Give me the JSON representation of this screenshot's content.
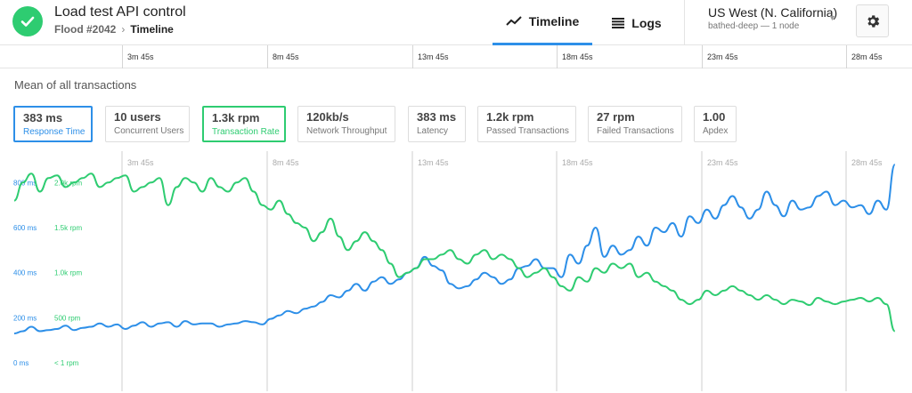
{
  "header": {
    "title": "Load test API control",
    "breadcrumb": {
      "parent": "Flood #2042",
      "current": "Timeline"
    },
    "tabs": [
      {
        "label": "Timeline",
        "icon": "trend-line-icon",
        "active": true
      },
      {
        "label": "Logs",
        "icon": "list-icon",
        "active": false
      }
    ],
    "region": {
      "name": "US West (N. California)",
      "subtitle": "bathed-deep — 1 node"
    },
    "status_icon": "check-icon",
    "settings_icon": "gear-icon"
  },
  "time_axis": [
    "3m 45s",
    "8m 45s",
    "13m 45s",
    "18m 45s",
    "23m 45s",
    "28m 45s"
  ],
  "section_title": "Mean of all transactions",
  "metrics": [
    {
      "value": "383 ms",
      "label": "Response Time",
      "selected": "blue"
    },
    {
      "value": "10 users",
      "label": "Concurrent Users",
      "selected": ""
    },
    {
      "value": "1.3k rpm",
      "label": "Transaction Rate",
      "selected": "green"
    },
    {
      "value": "120kb/s",
      "label": "Network Throughput",
      "selected": ""
    },
    {
      "value": "383 ms",
      "label": "Latency",
      "selected": ""
    },
    {
      "value": "1.2k rpm",
      "label": "Passed Transactions",
      "selected": ""
    },
    {
      "value": "27 rpm",
      "label": "Failed Transactions",
      "selected": ""
    },
    {
      "value": "1.00",
      "label": "Apdex",
      "selected": ""
    }
  ],
  "colors": {
    "response": "#2d8fe8",
    "transaction": "#2ecc71",
    "status": "#2ecc71"
  },
  "chart_data": {
    "type": "line",
    "x_ticks": [
      "3m 45s",
      "8m 45s",
      "13m 45s",
      "18m 45s",
      "23m 45s",
      "28m 45s"
    ],
    "y_left_ticks": [
      "0 ms",
      "200 ms",
      "400 ms",
      "600 ms",
      "800 ms"
    ],
    "y_right_ticks": [
      "< 1 rpm",
      "500 rpm",
      "1.0k rpm",
      "1.5k rpm",
      "2.0k rpm"
    ],
    "ylim_response_ms": [
      0,
      900
    ],
    "ylim_transaction_rpm": [
      0,
      2250
    ],
    "x_range_min": [
      0,
      31
    ],
    "series": [
      {
        "name": "Response Time",
        "axis": "left",
        "x": [
          0,
          0.3,
          0.6,
          0.9,
          1.2,
          1.5,
          1.8,
          2.1,
          2.4,
          2.7,
          3,
          3.3,
          3.6,
          3.9,
          4.2,
          4.5,
          4.8,
          5.1,
          5.4,
          5.7,
          6,
          6.3,
          6.6,
          6.9,
          7.2,
          7.5,
          7.8,
          8.1,
          8.4,
          8.7,
          9,
          9.3,
          9.6,
          9.9,
          10.2,
          10.5,
          10.8,
          11.1,
          11.4,
          11.7,
          12,
          12.3,
          12.6,
          12.9,
          13.2,
          13.5,
          13.8,
          14.1,
          14.4,
          14.7,
          15,
          15.3,
          15.6,
          15.9,
          16.2,
          16.5,
          16.8,
          17.1,
          17.4,
          17.7,
          18,
          18.3,
          18.6,
          18.9,
          19.2,
          19.5,
          19.8,
          20.1,
          20.4,
          20.7,
          21,
          21.3,
          21.6,
          21.9,
          22.2,
          22.5,
          22.8,
          23.1,
          23.4,
          23.7,
          24,
          24.3,
          24.6,
          24.9,
          25.2,
          25.5,
          25.8,
          26.1,
          26.4,
          26.7,
          27,
          27.3,
          27.6,
          27.9,
          28.2,
          28.5,
          28.8,
          29.1,
          29.4,
          29.7,
          30,
          30.3,
          30.6,
          30.9
        ],
        "values": [
          130,
          140,
          160,
          140,
          145,
          150,
          165,
          145,
          155,
          160,
          175,
          160,
          170,
          150,
          165,
          180,
          160,
          175,
          180,
          160,
          185,
          170,
          175,
          175,
          160,
          170,
          175,
          185,
          180,
          170,
          195,
          210,
          230,
          220,
          240,
          250,
          270,
          300,
          290,
          320,
          350,
          320,
          360,
          380,
          350,
          370,
          400,
          420,
          470,
          430,
          410,
          350,
          330,
          340,
          370,
          400,
          380,
          350,
          370,
          420,
          430,
          460,
          420,
          420,
          380,
          480,
          440,
          520,
          600,
          470,
          520,
          480,
          500,
          560,
          520,
          600,
          580,
          620,
          560,
          650,
          620,
          680,
          640,
          700,
          740,
          690,
          640,
          680,
          760,
          700,
          650,
          720,
          680,
          690,
          740,
          760,
          700,
          720,
          690,
          700,
          660,
          720,
          680,
          880
        ]
      },
      {
        "name": "Transaction Rate",
        "axis": "right",
        "x": [
          0,
          0.3,
          0.6,
          0.9,
          1.2,
          1.5,
          1.8,
          2.1,
          2.4,
          2.7,
          3,
          3.3,
          3.6,
          3.9,
          4.2,
          4.5,
          4.8,
          5.1,
          5.4,
          5.7,
          6,
          6.3,
          6.6,
          6.9,
          7.2,
          7.5,
          7.8,
          8.1,
          8.4,
          8.7,
          9,
          9.3,
          9.6,
          9.9,
          10.2,
          10.5,
          10.8,
          11.1,
          11.4,
          11.7,
          12,
          12.3,
          12.6,
          12.9,
          13.2,
          13.5,
          13.8,
          14.1,
          14.4,
          14.7,
          15,
          15.3,
          15.6,
          15.9,
          16.2,
          16.5,
          16.8,
          17.1,
          17.4,
          17.7,
          18,
          18.3,
          18.6,
          18.9,
          19.2,
          19.5,
          19.8,
          20.1,
          20.4,
          20.7,
          21,
          21.3,
          21.6,
          21.9,
          22.2,
          22.5,
          22.8,
          23.1,
          23.4,
          23.7,
          24,
          24.3,
          24.6,
          24.9,
          25.2,
          25.5,
          25.8,
          26.1,
          26.4,
          26.7,
          27,
          27.3,
          27.6,
          27.9,
          28.2,
          28.5,
          28.8,
          29.1,
          29.4,
          29.7,
          30,
          30.3,
          30.6,
          30.9
        ],
        "values": [
          1800,
          2000,
          2100,
          1900,
          2050,
          2080,
          1950,
          2000,
          2050,
          2100,
          1950,
          2000,
          2050,
          2080,
          1900,
          1950,
          2000,
          2050,
          1750,
          1950,
          2050,
          2000,
          1900,
          2050,
          1950,
          1900,
          2000,
          2050,
          1900,
          1750,
          1700,
          1800,
          1650,
          1550,
          1500,
          1350,
          1450,
          1600,
          1400,
          1250,
          1350,
          1450,
          1350,
          1250,
          1100,
          950,
          1000,
          1050,
          1150,
          1150,
          1200,
          1250,
          1150,
          1100,
          1200,
          1250,
          1150,
          1200,
          1150,
          1050,
          950,
          1000,
          1050,
          950,
          850,
          800,
          950,
          900,
          1050,
          1000,
          1100,
          1050,
          1100,
          950,
          1000,
          900,
          850,
          800,
          700,
          650,
          700,
          800,
          750,
          800,
          850,
          800,
          750,
          700,
          750,
          700,
          650,
          700,
          680,
          640,
          720,
          680,
          650,
          680,
          700,
          720,
          680,
          720,
          650,
          350
        ]
      }
    ]
  }
}
